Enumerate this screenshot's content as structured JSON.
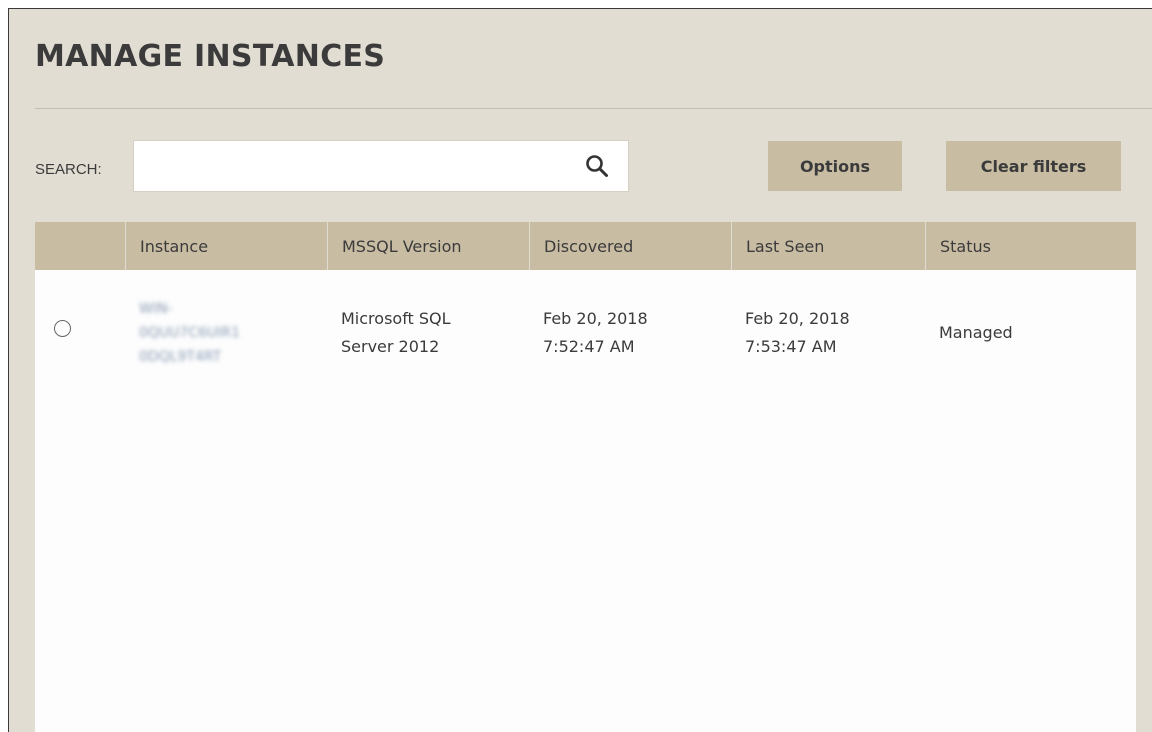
{
  "page": {
    "title": "MANAGE INSTANCES"
  },
  "search": {
    "label": "SEARCH:",
    "value": "",
    "placeholder": "",
    "icon": "search-icon"
  },
  "toolbar": {
    "options_label": "Options",
    "clear_filters_label": "Clear filters"
  },
  "table": {
    "columns": [
      "",
      "Instance",
      "MSSQL Version",
      "Discovered",
      "Last Seen",
      "Status"
    ],
    "rows": [
      {
        "selected": false,
        "instance_lines": [
          "WIN-",
          "0QUU7C6UIR1",
          "0DQL9T4RT"
        ],
        "version_line1": "Microsoft SQL",
        "version_line2": "Server 2012",
        "discovered_date": "Feb 20, 2018",
        "discovered_time": "7:52:47 AM",
        "last_seen_date": "Feb 20, 2018",
        "last_seen_time": "7:53:47 AM",
        "status": "Managed"
      }
    ]
  },
  "colors": {
    "background": "#e2ddd2",
    "header_accent": "#c8bca3",
    "text": "#3b3b3b"
  }
}
